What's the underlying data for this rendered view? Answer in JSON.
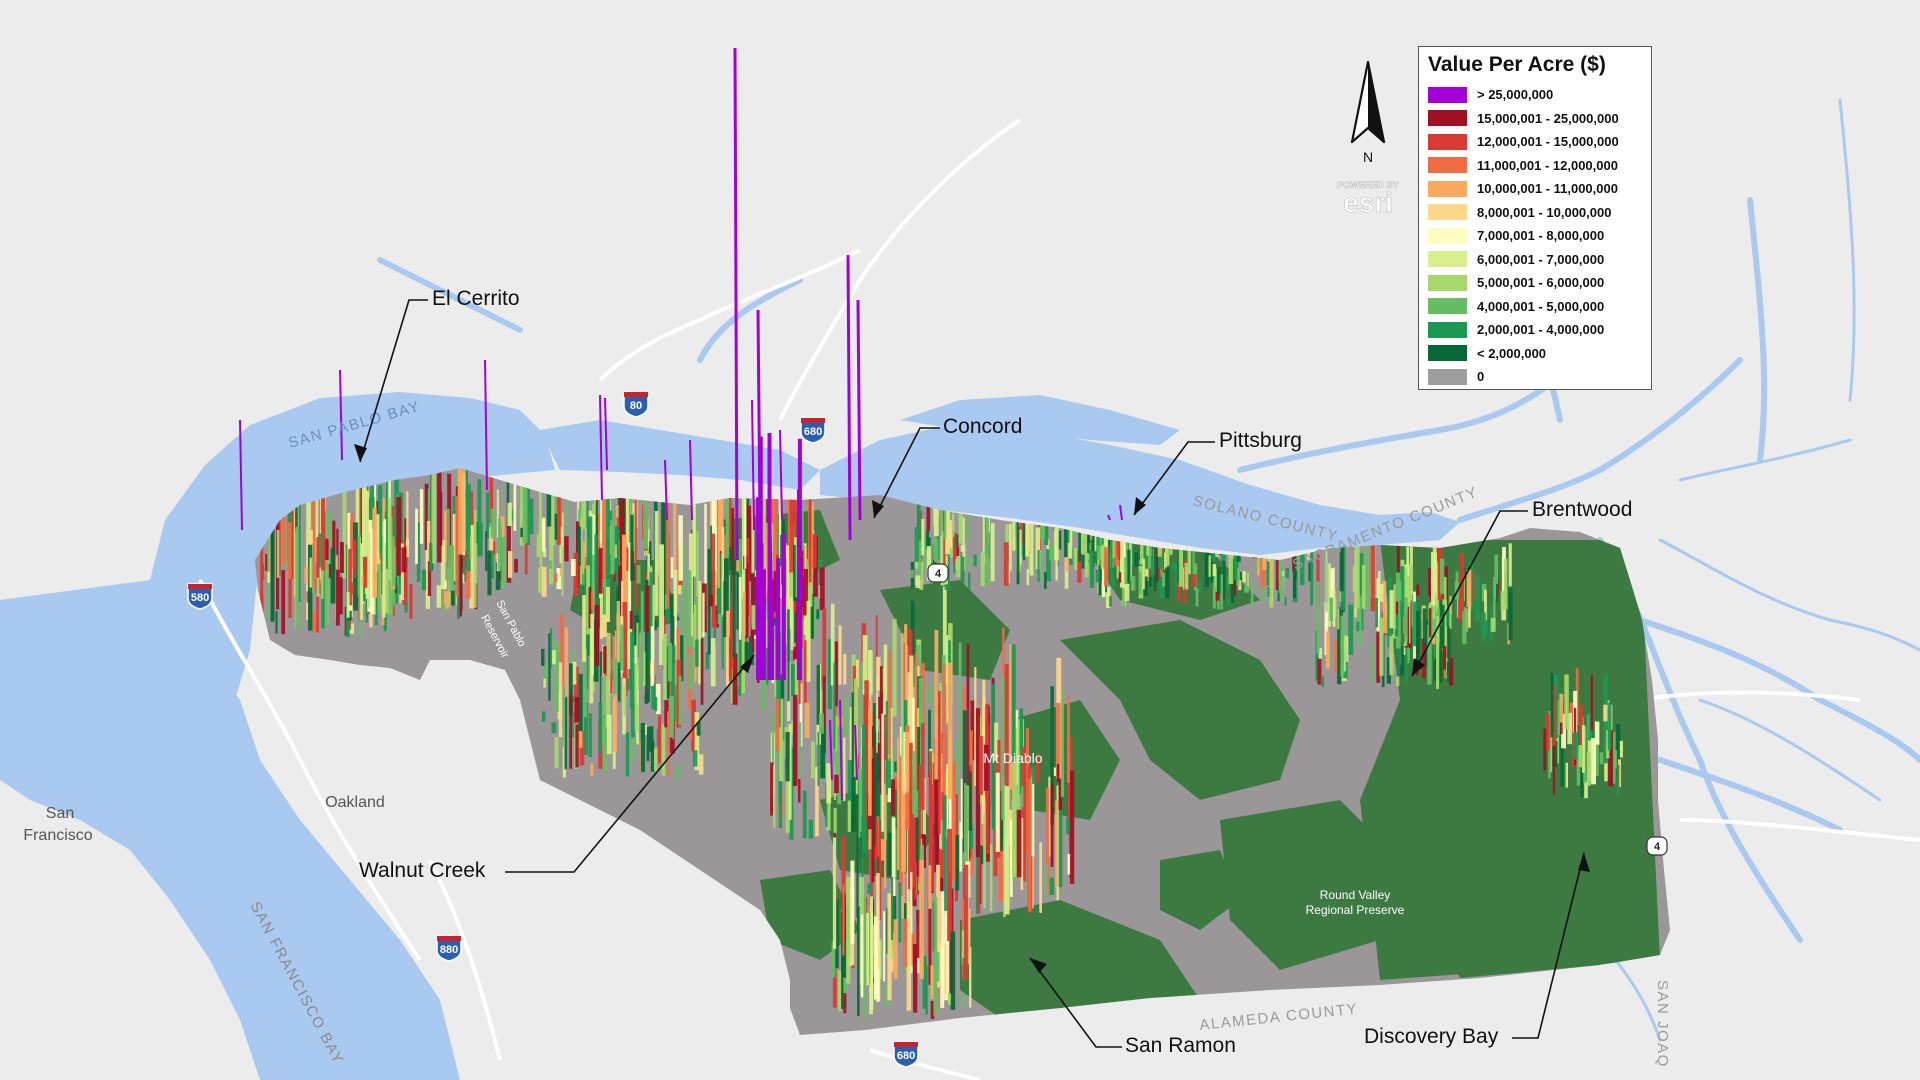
{
  "legend": {
    "title": "Value Per Acre ($)",
    "items": [
      {
        "label": "> 25,000,000",
        "color": "#a300d9"
      },
      {
        "label": "15,000,001 - 25,000,000",
        "color": "#a10f24"
      },
      {
        "label": "12,000,001 - 15,000,000",
        "color": "#d93a31"
      },
      {
        "label": "11,000,001 - 12,000,000",
        "color": "#f16c43"
      },
      {
        "label": "10,000,001 - 11,000,000",
        "color": "#fca960"
      },
      {
        "label": "8,000,001 - 10,000,000",
        "color": "#fed88b"
      },
      {
        "label": "7,000,001 - 8,000,000",
        "color": "#fefec0"
      },
      {
        "label": "6,000,001 - 7,000,000",
        "color": "#d9ef8b"
      },
      {
        "label": "5,000,001 - 6,000,000",
        "color": "#a6d96a"
      },
      {
        "label": "4,000,001 - 5,000,000",
        "color": "#66bd63"
      },
      {
        "label": "2,000,001 - 4,000,000",
        "color": "#1b9852"
      },
      {
        "label": "< 2,000,000",
        "color": "#066837"
      },
      {
        "label": "0",
        "color": "#9e9e9e"
      }
    ]
  },
  "north_arrow": {
    "label": "N"
  },
  "attribution": {
    "top": "POWERED BY",
    "brand": "esri"
  },
  "callouts": {
    "el_cerrito": "El Cerrito",
    "concord": "Concord",
    "pittsburg": "Pittsburg",
    "brentwood": "Brentwood",
    "walnut_creek": "Walnut Creek",
    "san_ramon": "San Ramon",
    "discovery_bay": "Discovery Bay"
  },
  "places": {
    "san_francisco_1": "San",
    "san_francisco_2": "Francisco",
    "oakland": "Oakland",
    "mt_diablo": "Mt Diablo",
    "round_valley_1": "Round Valley",
    "round_valley_2": "Regional Preserve",
    "san_pablo_reservoir_1": "San Pablo",
    "san_pablo_reservoir_2": "Reservoir"
  },
  "water_labels": {
    "san_pablo_bay": "SAN PABLO BAY",
    "san_francisco_bay": "SAN FRANCISCO BAY"
  },
  "county_labels": {
    "solano": "SOLANO COUNTY",
    "sacramento": "SACRAMENTO COUNTY",
    "alameda": "ALAMEDA COUNTY",
    "san_joaquin": "SAN JOAQ"
  },
  "highways": {
    "i580": "580",
    "i80": "80",
    "i680_north": "680",
    "i880": "880",
    "i680_south": "680",
    "sr4_concord": "4",
    "sr4_east": "4"
  },
  "colors": {
    "land": "#ececec",
    "water": "#a9c9f0",
    "county_fill": "#9b9799",
    "open_space": "#3d7a42"
  }
}
